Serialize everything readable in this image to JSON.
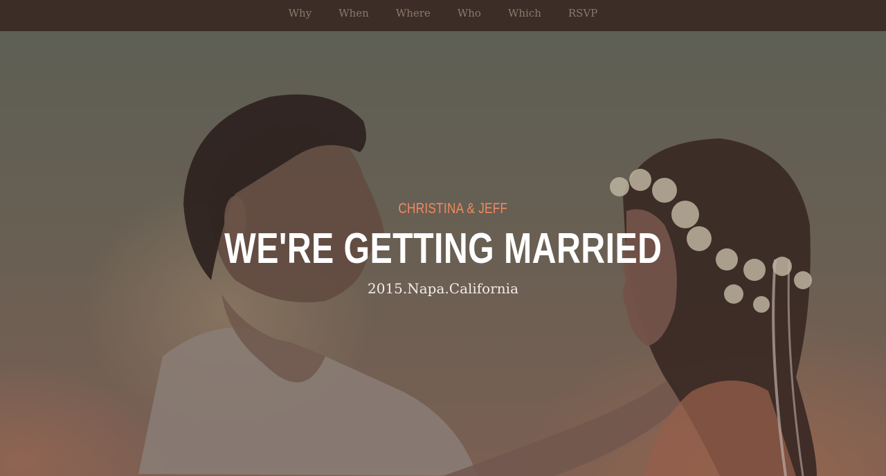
{
  "nav": {
    "items": [
      {
        "label": "Why"
      },
      {
        "label": "When"
      },
      {
        "label": "Where"
      },
      {
        "label": "Who"
      },
      {
        "label": "Which"
      },
      {
        "label": "RSVP"
      }
    ]
  },
  "hero": {
    "names": "CHRISTINA & JEFF",
    "headline": "WE'RE GETTING MARRIED",
    "details": "2015.Napa.California",
    "image": "couple-photo"
  },
  "colors": {
    "nav_background": "#3d2d27",
    "nav_text": "#8a7a6a",
    "accent": "#f08a60",
    "headline": "#ffffff"
  }
}
